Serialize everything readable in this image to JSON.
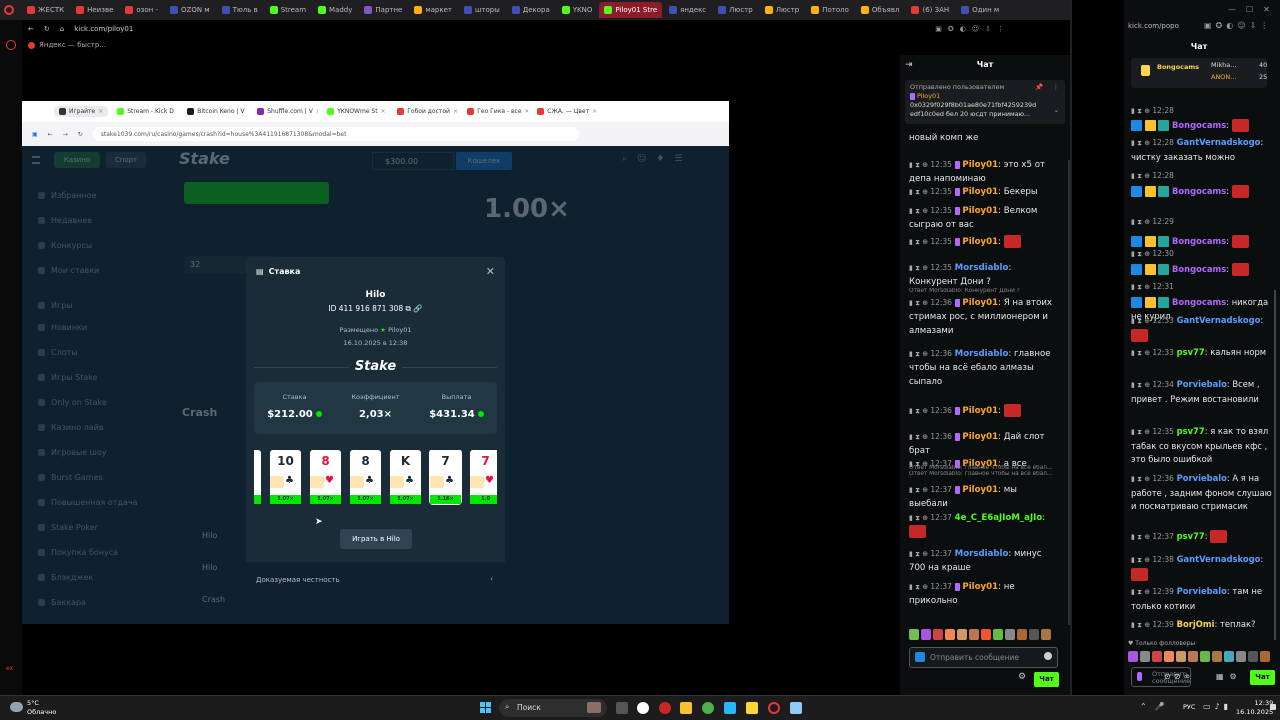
{
  "browser": {
    "tabs": [
      {
        "label": "ЖЕСТК",
        "color": "#e53935"
      },
      {
        "label": "Неизве",
        "color": "#e53935"
      },
      {
        "label": "озон -",
        "color": "#e53935"
      },
      {
        "label": "OZON м",
        "color": "#3f51b5"
      },
      {
        "label": "Тюль в",
        "color": "#3f51b5"
      },
      {
        "label": "Stream",
        "color": "#53fc18"
      },
      {
        "label": "Maddy",
        "color": "#53fc18"
      },
      {
        "label": "Партне",
        "color": "#7e57c2"
      },
      {
        "label": "маркет",
        "color": "#ffb300"
      },
      {
        "label": "шторы",
        "color": "#3f51b5"
      },
      {
        "label": "Декора",
        "color": "#3f51b5"
      },
      {
        "label": "YKNO",
        "color": "#53fc18"
      },
      {
        "label": "Piloy01 Stre",
        "color": "#53fc18"
      },
      {
        "label": "яндекс",
        "color": "#3f51b5"
      },
      {
        "label": "Люстр",
        "color": "#3f51b5"
      },
      {
        "label": "Люстр",
        "color": "#ffb300"
      },
      {
        "label": "Потоло",
        "color": "#ffb300"
      },
      {
        "label": "Объявл",
        "color": "#ffb300"
      },
      {
        "label": "(6) ЗАН",
        "color": "#e53935"
      },
      {
        "label": "Один м",
        "color": "#3f51b5"
      }
    ],
    "url": "kick.com/piloy01",
    "bookmark": "Яндекс — быстр..."
  },
  "inner_browser": {
    "tabs": [
      {
        "label": "Играйте",
        "color": "#333",
        "active": true
      },
      {
        "label": "Stream - Kick D",
        "color": "#53fc18"
      },
      {
        "label": "Bitcoin Keno | V",
        "color": "#1a1a1a"
      },
      {
        "label": "Shuffle.com | V",
        "color": "#8e24aa"
      },
      {
        "label": "YKNOWme St",
        "color": "#53fc18"
      },
      {
        "label": "Гобои достой",
        "color": "#e53935"
      },
      {
        "label": "Гео Гика - все",
        "color": "#e53935"
      },
      {
        "label": "СЖА. — Цвет",
        "color": "#e53935"
      }
    ],
    "url": "stake1039.com/ru/casino/games/crash?id=house%3A411916871308&modal=bet"
  },
  "stake_bg": {
    "logo": "Stake",
    "balance": "$300.00",
    "wallet": "Кошелек",
    "tab_casino": "Казино",
    "tab_sport": "Спорт",
    "multiplier": "1.00×",
    "nav": [
      "Избранное",
      "Недавнее",
      "Конкурсы",
      "Мои ставки",
      "Игры",
      "Новинки",
      "Слоты",
      "Игры Stake",
      "Only on Stake",
      "Казино лайв",
      "Игровые шоу",
      "Burst Games",
      "Повышенная отдача",
      "Stake Poker",
      "Покупка бонуса",
      "Блэкджек",
      "Баккара"
    ],
    "crash": "Crash",
    "rows": [
      "Hilo",
      "Hilo",
      "Crash"
    ]
  },
  "modal": {
    "title": "Ставка",
    "game": "Hilo",
    "bet_id": "ID 411 916 871 308",
    "placed_by_label": "Размещено",
    "placed_by": "Piloy01",
    "datetime": "16.10.2025 в 12:38",
    "brand": "Stake",
    "stats": [
      {
        "label": "Ставка",
        "value": "$212.00"
      },
      {
        "label": "Коэффициент",
        "value": "2,03×"
      },
      {
        "label": "Выплата",
        "value": "$431.34"
      }
    ],
    "cards": [
      {
        "rank": "",
        "suit": "",
        "mult": "1.07×",
        "red": false
      },
      {
        "rank": "10",
        "suit": "♣",
        "mult": "1.07×",
        "red": false
      },
      {
        "rank": "8",
        "suit": "♥",
        "mult": "1.07×",
        "red": true
      },
      {
        "rank": "8",
        "suit": "♣",
        "mult": "1.07×",
        "red": false
      },
      {
        "rank": "K",
        "suit": "♣",
        "mult": "1.07×",
        "red": false
      },
      {
        "rank": "7",
        "suit": "♣",
        "mult": "1.16×",
        "red": false
      },
      {
        "rank": "7",
        "suit": "♥",
        "mult": "1.0",
        "red": true
      }
    ],
    "play_button": "Играть в Hilo",
    "fairness": "Доказуемая честность"
  },
  "chat1": {
    "header": "Чат",
    "pinned_label": "Отправлено пользователем",
    "pinned_user": "Piloy01",
    "pinned_text": "0x0329f029f8b01ae80e71fbf4259239d edf10c0ed бел 20 юсдт принимаю...",
    "messages": [
      {
        "time": "",
        "user": "",
        "text": "новый комп же",
        "color": "#fff"
      },
      {
        "time": "12:35",
        "user": "Piloy01",
        "text": "это x5 от депа напоминаю",
        "color": "#ffa726"
      },
      {
        "time": "12:35",
        "user": "Piloy01",
        "text": "Бекеры",
        "color": "#ffa726"
      },
      {
        "time": "12:35",
        "user": "Piloy01",
        "text": "Велком сыграю от вас",
        "color": "#ffa726"
      },
      {
        "time": "12:35",
        "user": "Piloy01",
        "text": "",
        "color": "#ffa726"
      },
      {
        "time": "12:35",
        "user": "Morsdiablo",
        "text": "Конкурент Дони ?",
        "color": "#5c9dff"
      },
      {
        "time": "12:36",
        "user": "Piloy01",
        "text": "Я на втоих стримах рос, с миллионером и алмазами",
        "color": "#ffa726"
      },
      {
        "time": "12:36",
        "user": "Morsdiablo",
        "text": "главное чтобы на всё ебало алмазы сыпало",
        "color": "#5c9dff"
      },
      {
        "time": "12:36",
        "user": "Piloy01",
        "text": "",
        "color": "#ffa726"
      },
      {
        "time": "12:36",
        "user": "Piloy01",
        "text": "Дай слот брат",
        "color": "#ffa726"
      },
      {
        "time": "12:37",
        "user": "Piloy01",
        "text": "а все",
        "color": "#ffa726"
      },
      {
        "time": "12:37",
        "user": "Piloy01",
        "text": "мы выебали",
        "color": "#ffa726"
      },
      {
        "time": "12:37",
        "user": "4e_C_E6aJIoM_aJIo",
        "text": "",
        "color": "#53fc18"
      },
      {
        "time": "12:37",
        "user": "Morsdiablo",
        "text": "минус 700 на краше",
        "color": "#5c9dff"
      },
      {
        "time": "12:37",
        "user": "Piloy01",
        "text": "не прикольно",
        "color": "#ffa726"
      }
    ],
    "replies": [
      "Ответ Morsdiablo: Конкурент Дони ?",
      "Ответ Morsdiablo: главное чтобы на всё ебал...",
      "Ответ Morsdiablo: главное чтобы на всё ебал..."
    ],
    "input_placeholder": "Отправить сообщение",
    "send": "Чат"
  },
  "chat2": {
    "url": "kick.com/popo",
    "header": "Чат",
    "top_users": [
      {
        "name": "Bongocams",
        "val": ""
      },
      {
        "name": "Mikha...",
        "val": "40"
      },
      {
        "name": "ANON...",
        "val": "25"
      }
    ],
    "messages": [
      {
        "time": "12:28",
        "user": "",
        "text": "",
        "color": "#fff"
      },
      {
        "time": "",
        "user": "Bongocams",
        "text": "",
        "color": "#b069ff"
      },
      {
        "time": "12:28",
        "user": "GantVernadskogo",
        "text": "чистку заказать можно",
        "color": "#5c9dff"
      },
      {
        "time": "12:28",
        "user": "",
        "text": "",
        "color": "#fff"
      },
      {
        "time": "",
        "user": "Bongocams",
        "text": "",
        "color": "#b069ff"
      },
      {
        "time": "12:29",
        "user": "",
        "text": "",
        "color": "#fff"
      },
      {
        "time": "",
        "user": "Bongocams",
        "text": "",
        "color": "#b069ff"
      },
      {
        "time": "12:30",
        "user": "",
        "text": "",
        "color": "#fff"
      },
      {
        "time": "",
        "user": "Bongocams",
        "text": "",
        "color": "#b069ff"
      },
      {
        "time": "12:31",
        "user": "",
        "text": "",
        "color": "#fff"
      },
      {
        "time": "",
        "user": "Bongocams",
        "text": "никогда не курил",
        "color": "#b069ff"
      },
      {
        "time": "12:33",
        "user": "GantVernadskogo",
        "text": "",
        "color": "#5c9dff"
      },
      {
        "time": "12:33",
        "user": "psv77",
        "text": "кальян норм",
        "color": "#53fc18"
      },
      {
        "time": "12:34",
        "user": "Porviebalo",
        "text": "Всем , привет . Режим востановили",
        "color": "#5c9dff"
      },
      {
        "time": "12:35",
        "user": "psv77",
        "text": "я как то взял табак со вкусом крыльев кфс , это было ошибкой",
        "color": "#53fc18"
      },
      {
        "time": "12:36",
        "user": "Porviebalo",
        "text": "А я на работе , задним фоном слушаю и посматриваю стримасик",
        "color": "#5c9dff"
      },
      {
        "time": "12:37",
        "user": "psv77",
        "text": "",
        "color": "#53fc18"
      },
      {
        "time": "12:38",
        "user": "GantVernadskogo",
        "text": "",
        "color": "#5c9dff"
      },
      {
        "time": "12:39",
        "user": "Porviebalo",
        "text": "там не только котики",
        "color": "#5c9dff"
      },
      {
        "time": "12:39",
        "user": "BorjOmi",
        "text": "теплак?",
        "color": "#ffd54f"
      }
    ],
    "followers_label": "Только фолловеры",
    "input_placeholder": "Отправить сообщение",
    "send": "Чат"
  },
  "taskbar": {
    "weather_temp": "5°C",
    "weather_desc": "Облачно",
    "search": "Поиск",
    "lang": "РУС",
    "time": "12:39",
    "date": "16.10.2025"
  }
}
